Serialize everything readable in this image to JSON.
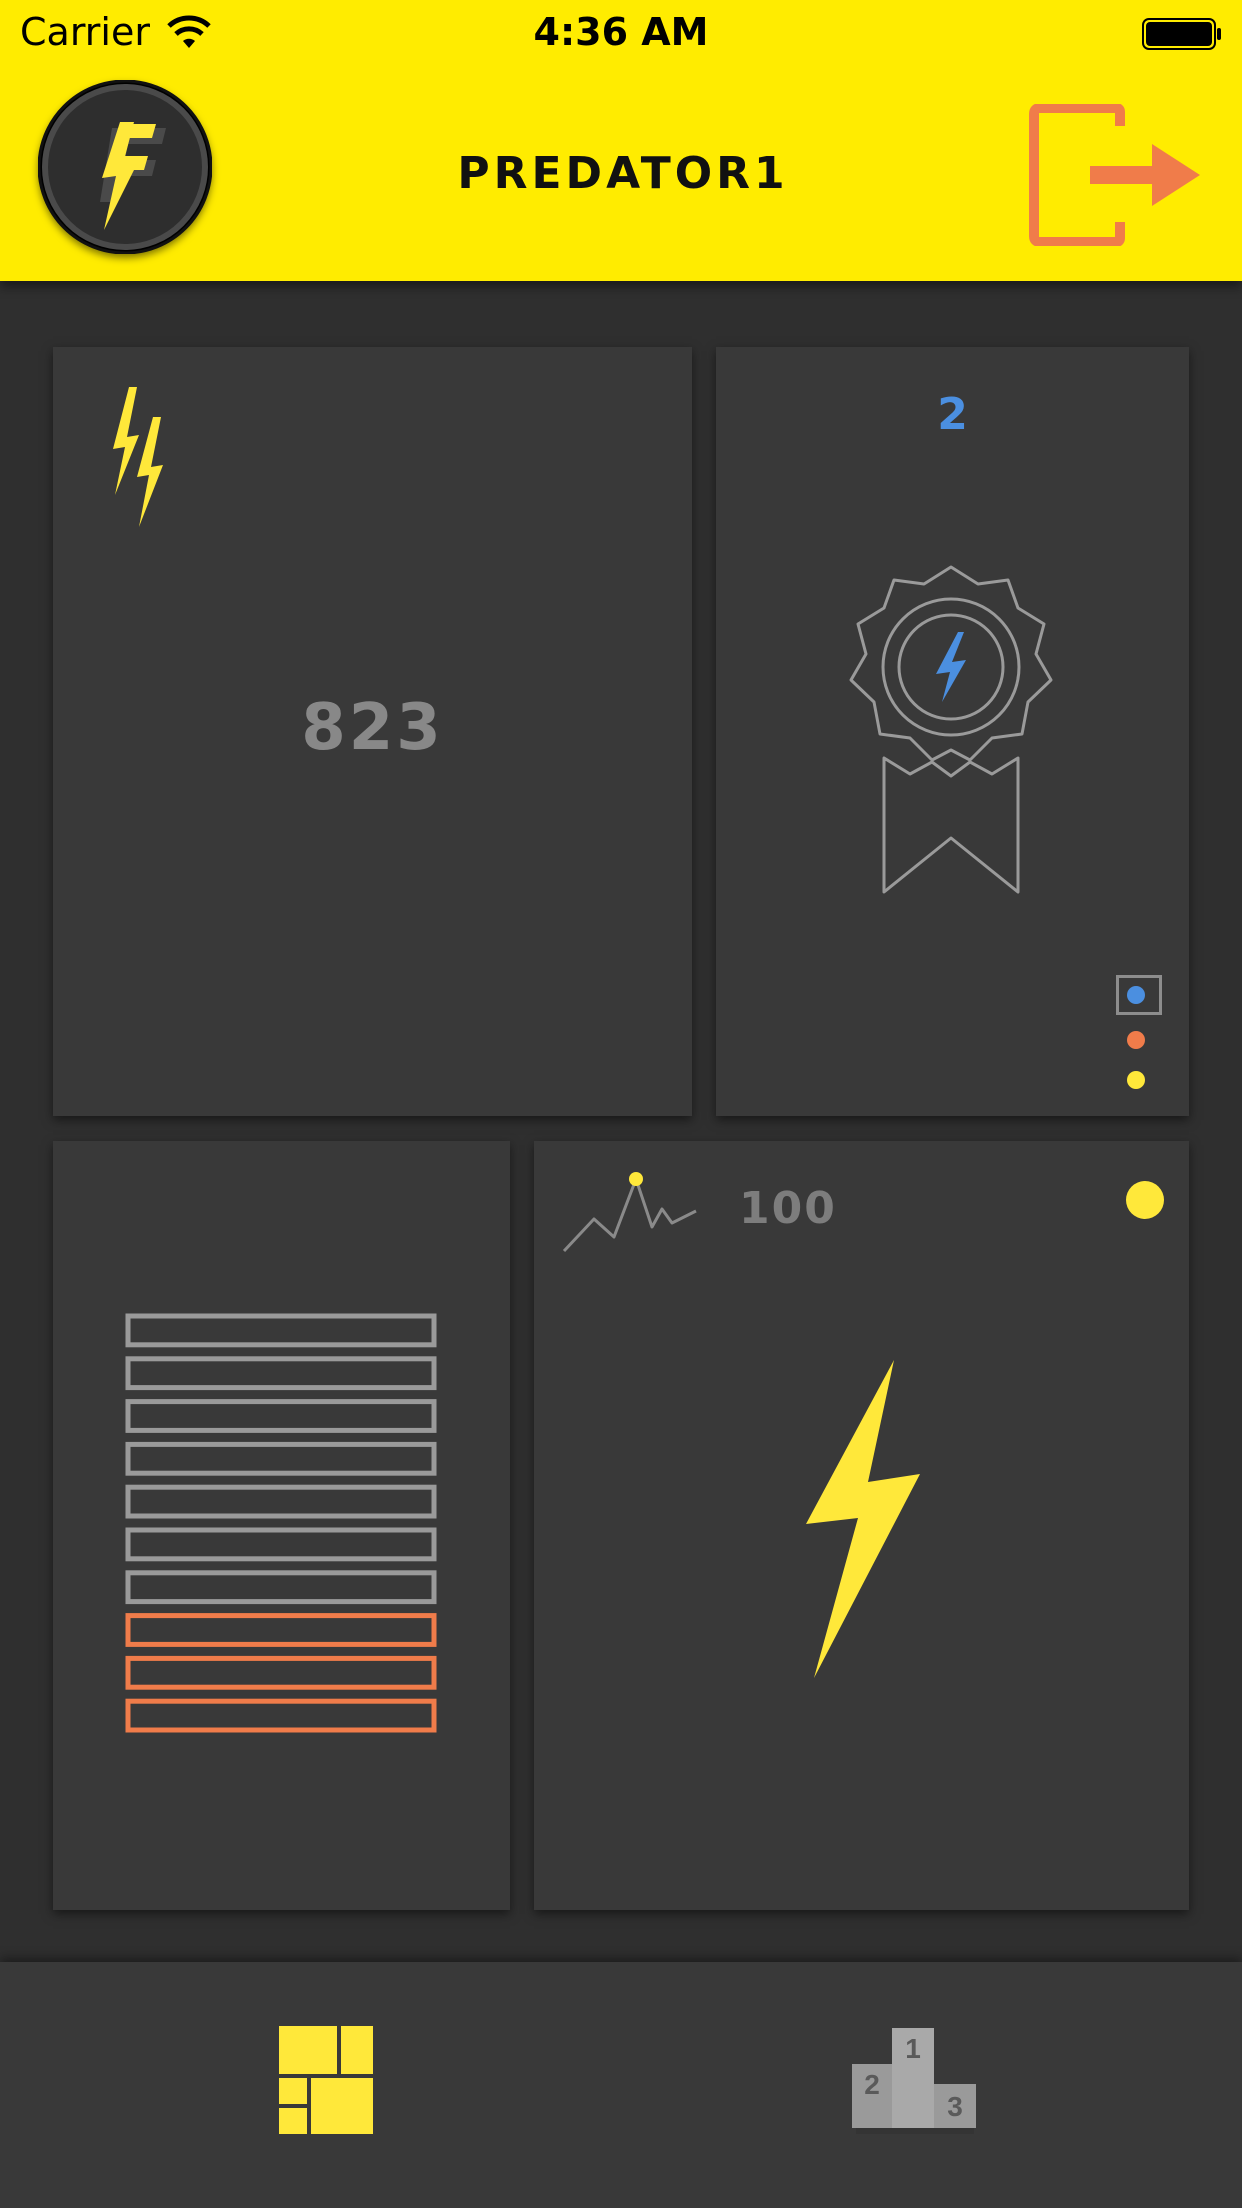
{
  "status_bar": {
    "carrier": "Carrier",
    "time": "4:36 AM"
  },
  "header": {
    "title": "PREDATOR",
    "title_number": "1",
    "logo_icon": "f-bolt-logo-icon",
    "logout_icon": "logout-icon"
  },
  "cards": {
    "energy": {
      "icon": "double-bolt-icon",
      "value": "823"
    },
    "badge": {
      "count": "2",
      "icon": "award-ribbon-icon",
      "pager": {
        "active_index": 0,
        "colors": [
          "#4b8fe0",
          "#f07c4a",
          "#ffe83a"
        ]
      }
    },
    "levels": {
      "icon": "level-stack-icon",
      "total_bars": 10,
      "filled_bars": 3,
      "bar_color_empty": "#9a9a9a",
      "bar_color_filled": "#f07c4a"
    },
    "boost": {
      "trend_icon": "trend-peak-icon",
      "value": "100",
      "status_color": "#ffe83a",
      "icon": "lightning-bolt-icon"
    }
  },
  "tabbar": {
    "items": [
      {
        "name": "dashboard",
        "icon": "dashboard-grid-icon",
        "active": true
      },
      {
        "name": "leaderboard",
        "icon": "podium-icon",
        "active": false
      }
    ],
    "podium_labels": [
      "1",
      "2",
      "3"
    ]
  },
  "colors": {
    "accent_yellow": "#ffec00",
    "accent_orange": "#f07c4a",
    "accent_blue": "#4b8fe0",
    "background": "#2f2f2f",
    "card": "#393939"
  }
}
